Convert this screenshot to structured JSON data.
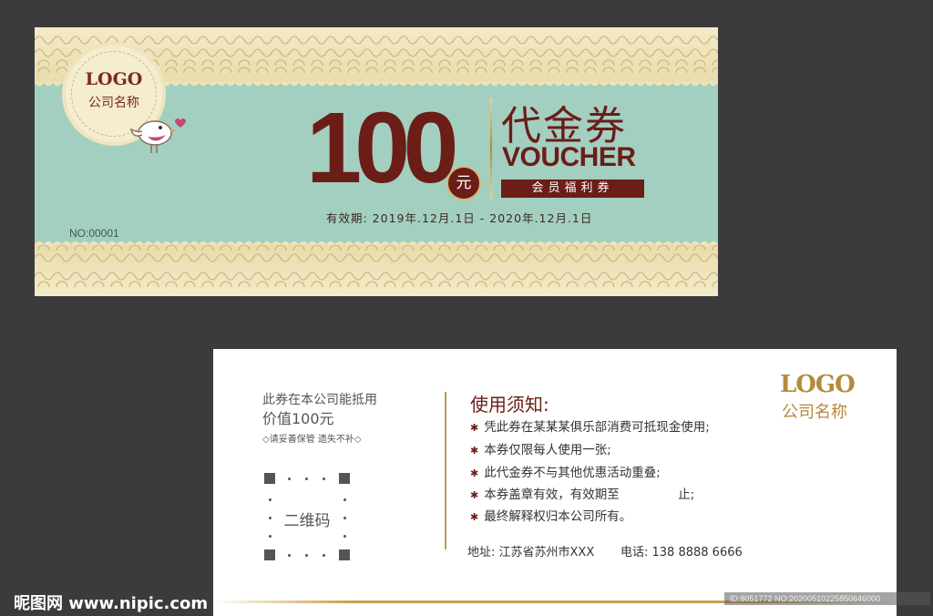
{
  "front": {
    "logo": "LOGO",
    "company": "公司名称",
    "serial": "NO:00001",
    "amount": "100",
    "currency": "元",
    "title_cn": "代金券",
    "title_en": "VOUCHER",
    "member_tag": "会员福利券",
    "validity": "有效期: 2019年.12月.1日 - 2020年.12月.1日",
    "colors": {
      "teal": "#a3cfc0",
      "cream": "#f3eac8",
      "maroon": "#6b1d17",
      "gold": "#c9a24a"
    }
  },
  "back": {
    "left_line1": "此券在本公司能抵用",
    "left_line2": "价值100元",
    "left_note": "◇请妥善保管 遗失不补◇",
    "qr_label": "二维码",
    "rules_title": "使用须知:",
    "rules": [
      "凭此券在某某某俱乐部消费可抵现金使用;",
      "本券仅限每人使用一张;",
      "此代金券不与其他优惠活动重叠;",
      "本券盖章有效，有效期至               止;",
      "最终解释权归本公司所有。"
    ],
    "logo": "LOGO",
    "company": "公司名称",
    "address": "地址: 江苏省苏州市XXX",
    "phone": "电话: 138 8888 6666"
  },
  "watermark": {
    "site": "昵图网 www.nipic.com",
    "id": "ID:8051772 NO:20200510225850646000"
  }
}
